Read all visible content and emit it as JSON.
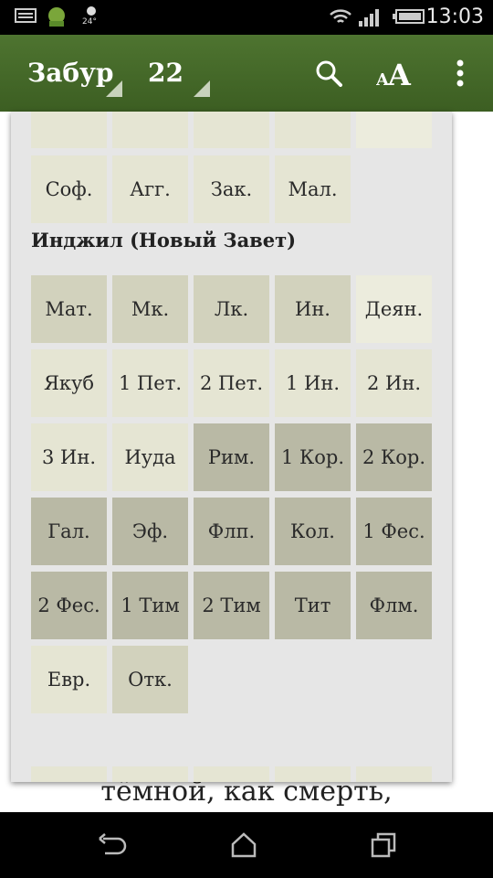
{
  "status_bar": {
    "time": "13:03",
    "temperature": "24°",
    "icons": [
      "keyboard-icon",
      "android-icon",
      "weather-icon",
      "wifi-icon",
      "signal-icon",
      "battery-icon"
    ]
  },
  "action_bar": {
    "book_spinner": "Забур",
    "chapter_spinner": "22",
    "icons": [
      "search-icon",
      "font-size-icon",
      "overflow-menu-icon"
    ]
  },
  "background_text": "тёмной, как смерть,",
  "popup": {
    "top_books": [
      "Соф.",
      "Агг.",
      "Зак.",
      "Мал."
    ],
    "section_title": "Инджил (Новый Завет)",
    "rows": [
      [
        "Мат.",
        "Мк.",
        "Лк.",
        "Ин.",
        "Деян."
      ],
      [
        "Якуб",
        "1 Пет.",
        "2 Пет.",
        "1 Ин.",
        "2 Ин."
      ],
      [
        "3 Ин.",
        "Иуда",
        "Рим.",
        "1 Кор.",
        "2 Кор."
      ],
      [
        "Гал.",
        "Эф.",
        "Флп.",
        "Кол.",
        "1 Фес."
      ],
      [
        "2 Фес.",
        "1 Тим",
        "2 Тим",
        "Тит",
        "Флм."
      ],
      [
        "Евр.",
        "Отк."
      ]
    ]
  },
  "colors": {
    "action_bar": "#4a6e2c",
    "popup_bg": "#e6e6e6",
    "cell_light": "#e5e5d3",
    "cell_mid": "#d2d2bd",
    "cell_dark": "#b9b9a5"
  }
}
